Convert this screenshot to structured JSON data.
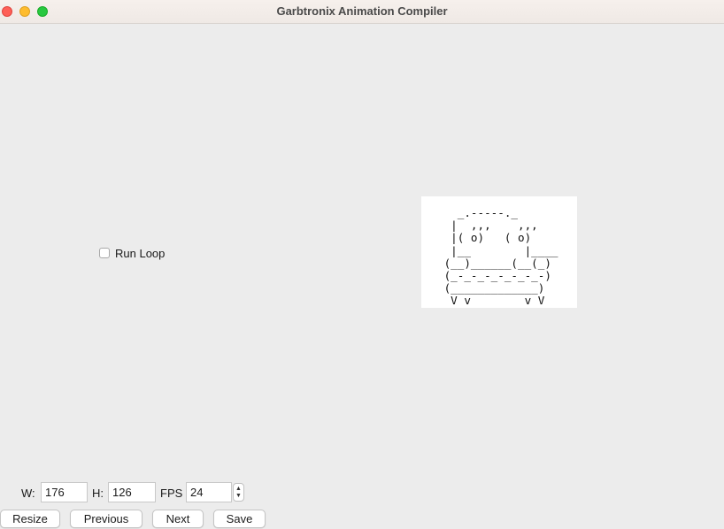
{
  "window": {
    "title": "Garbtronix Animation Compiler"
  },
  "checkbox": {
    "label": "Run Loop",
    "checked": false
  },
  "preview": {
    "ascii_art": "   _.-----._\n  |  ,,,    ,,,\n  |( o)   ( o)\n  |__        |____\n (__)______(__(_)\n (_-_-_-_-_-_-_-)\n (_____________)\n  V v        v V"
  },
  "controls": {
    "width_label": "W:",
    "width_value": "176",
    "height_label": "H:",
    "height_value": "126",
    "fps_label": "FPS",
    "fps_value": "24",
    "stepper_up_icon": "chevron-up-icon",
    "stepper_down_icon": "chevron-down-icon"
  },
  "buttons": {
    "resize": "Resize",
    "previous": "Previous",
    "next": "Next",
    "save": "Save"
  }
}
